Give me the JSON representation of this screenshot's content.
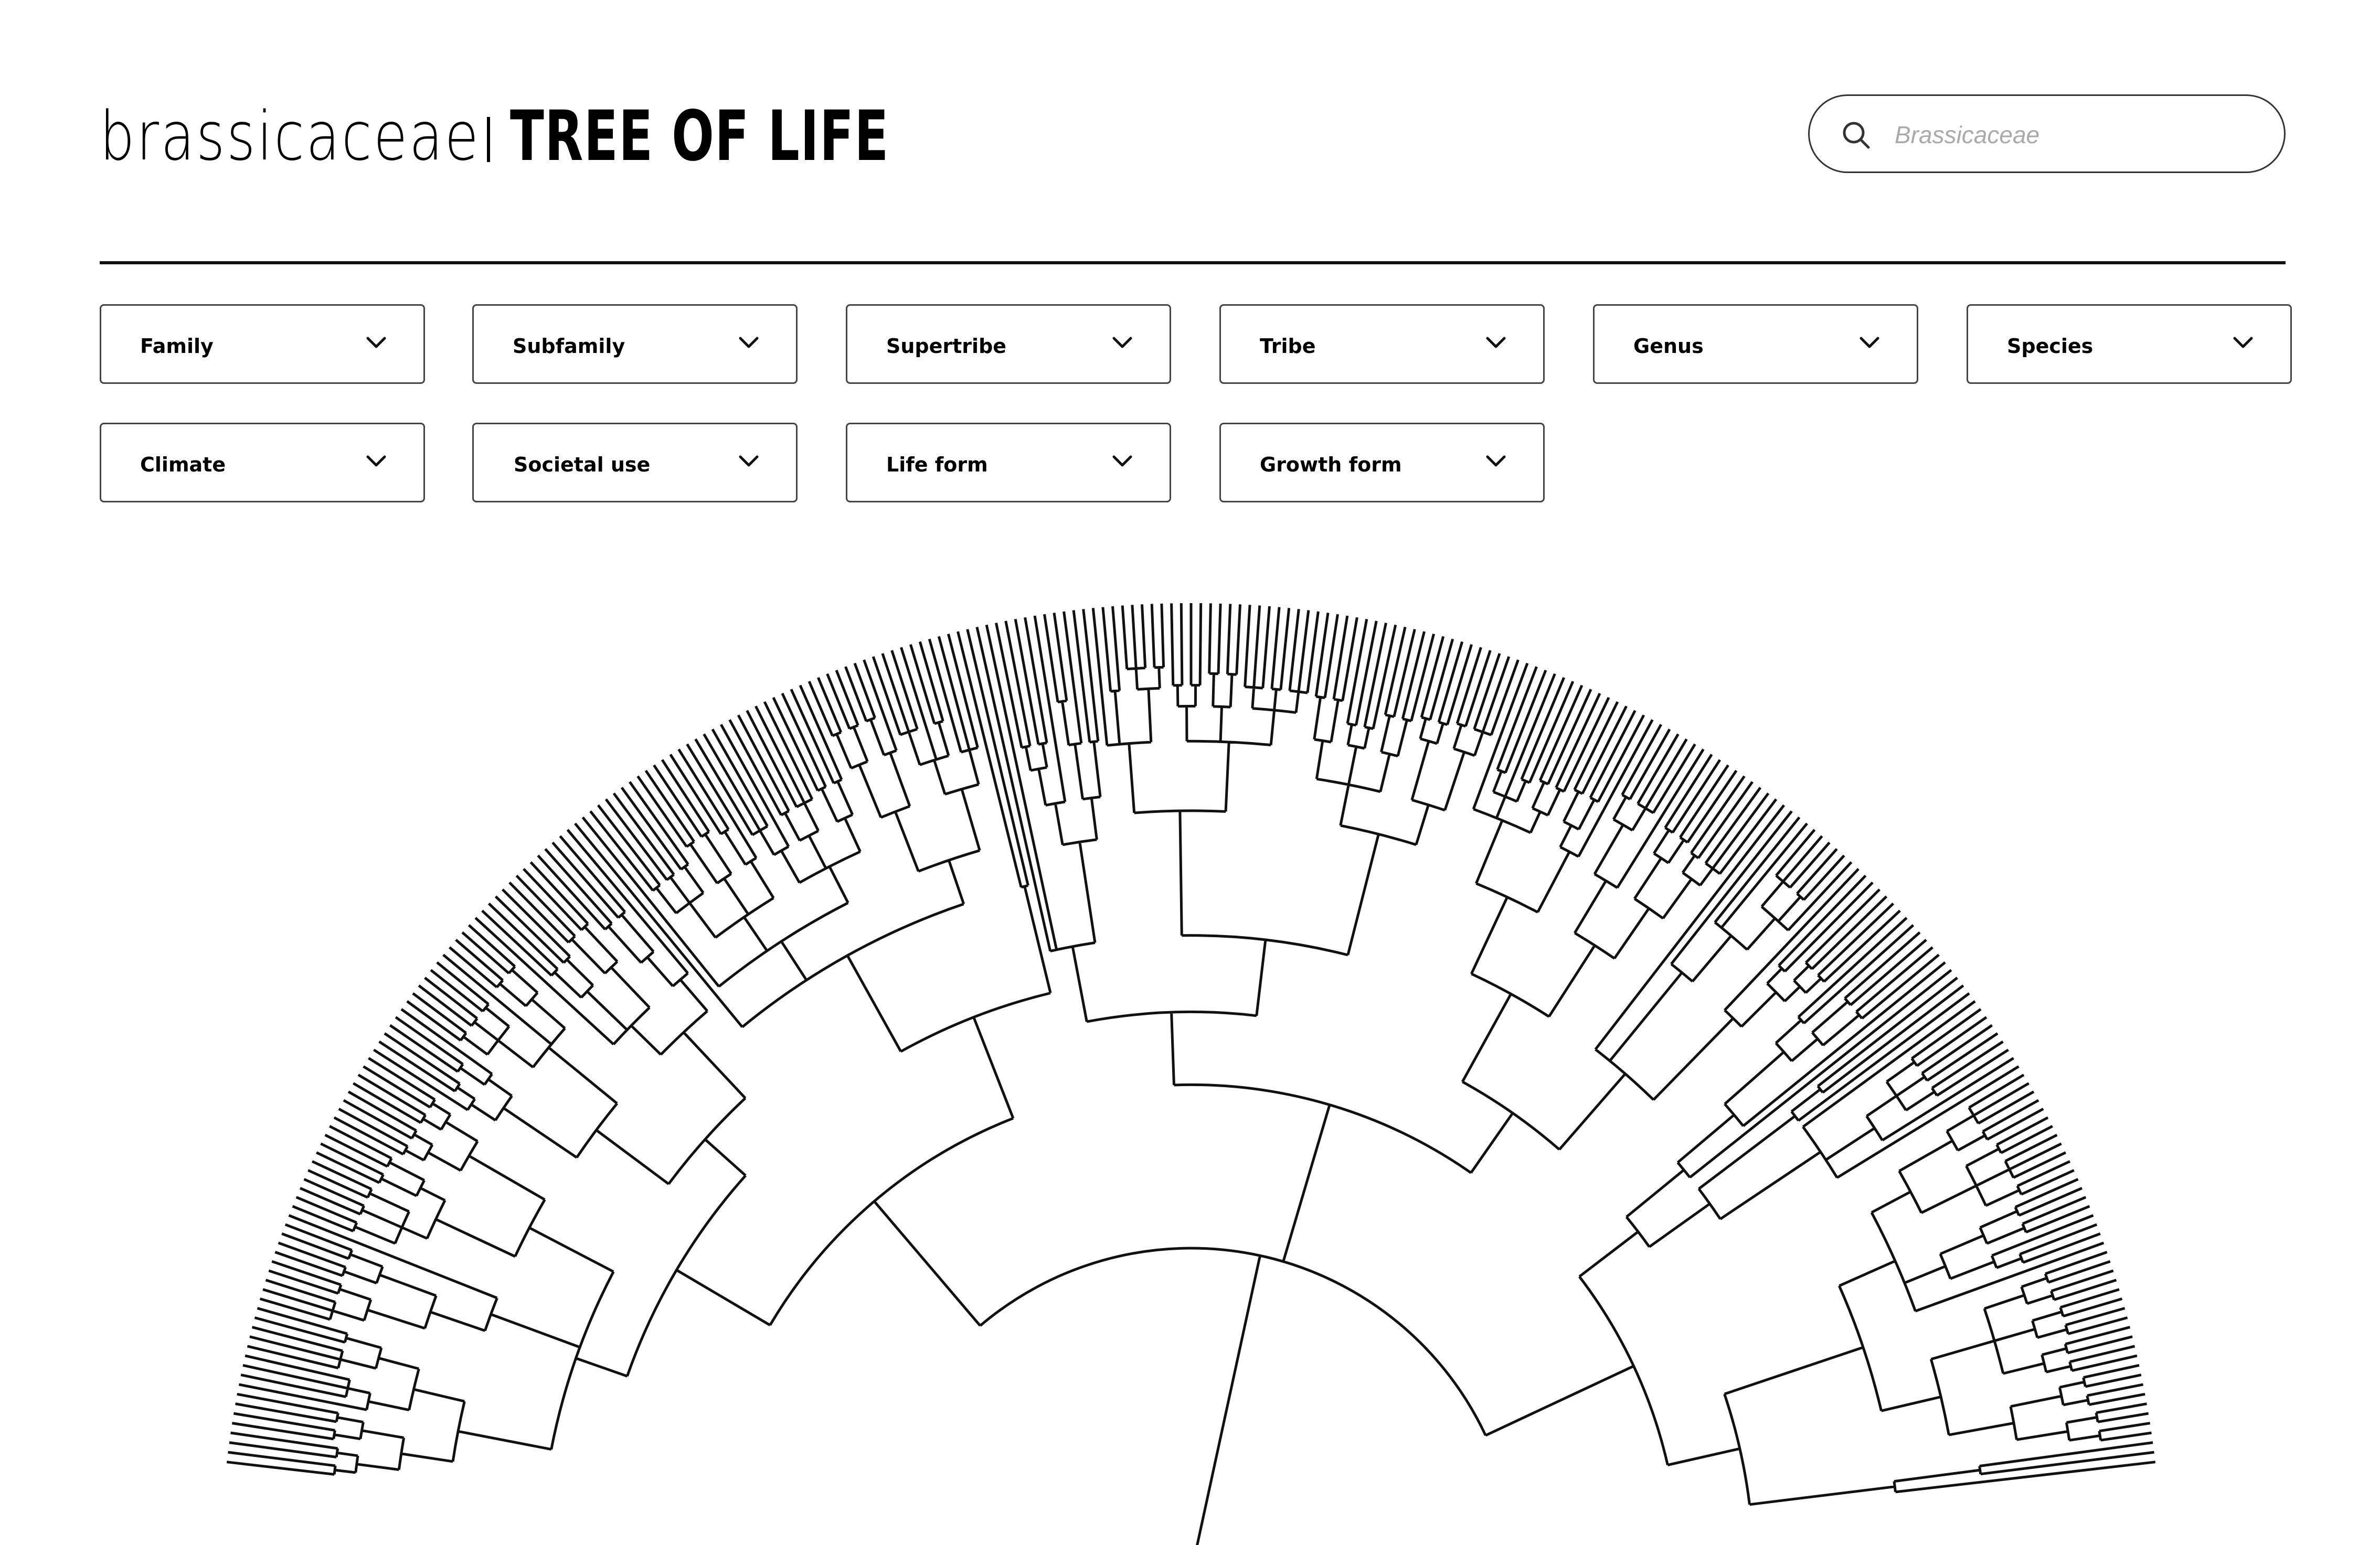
{
  "header": {
    "brand_light": "brassicaceae",
    "brand_bold": "TREE OF LIFE"
  },
  "search": {
    "placeholder": "Brassicaceae",
    "value": "",
    "icon": "search-icon"
  },
  "filters_row1": [
    {
      "label": "Family",
      "icon": "chevron-down-icon"
    },
    {
      "label": "Subfamily",
      "icon": "chevron-down-icon"
    },
    {
      "label": "Supertribe",
      "icon": "chevron-down-icon"
    },
    {
      "label": "Tribe",
      "icon": "chevron-down-icon"
    },
    {
      "label": "Genus",
      "icon": "chevron-down-icon"
    },
    {
      "label": "Species",
      "icon": "chevron-down-icon"
    }
  ],
  "filters_row2": [
    {
      "label": "Climate",
      "icon": "chevron-down-icon"
    },
    {
      "label": "Societal use",
      "icon": "chevron-down-icon"
    },
    {
      "label": "Life form",
      "icon": "chevron-down-icon"
    },
    {
      "label": "Growth form",
      "icon": "chevron-down-icon"
    }
  ],
  "colors": {
    "stroke": "#111111",
    "background": "#ffffff",
    "placeholder": "#aaaaaa"
  }
}
